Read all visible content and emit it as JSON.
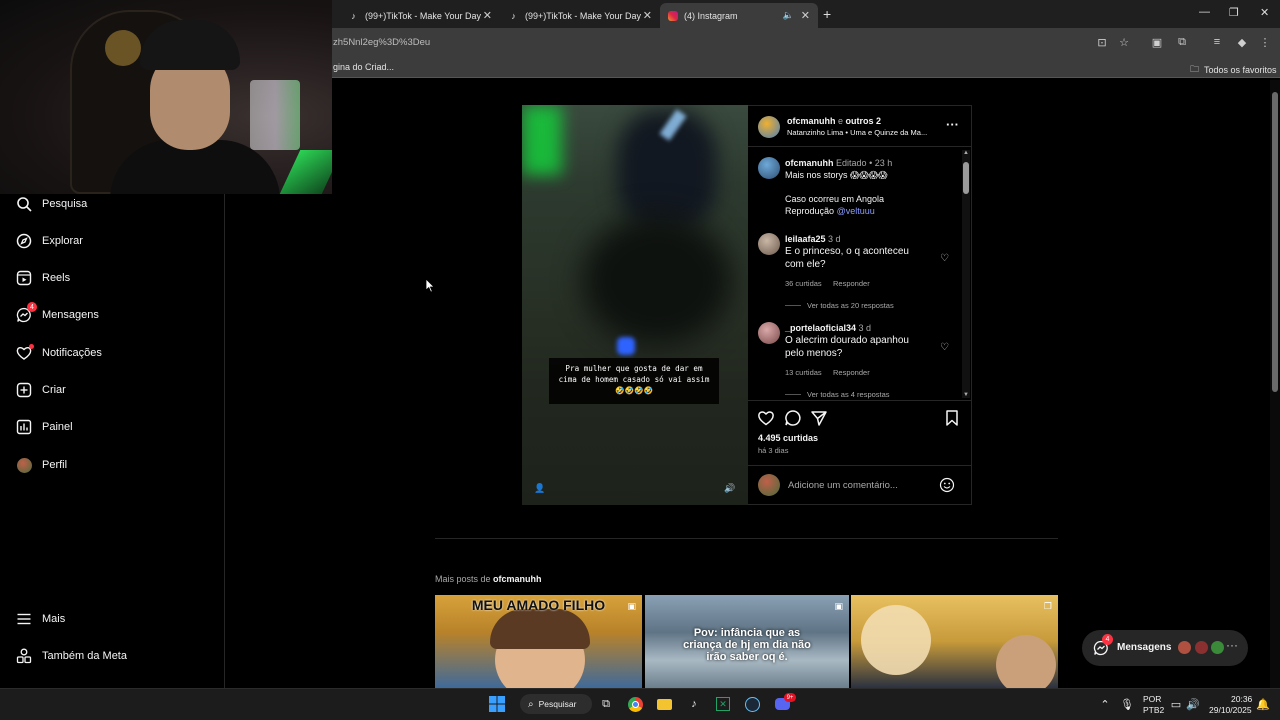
{
  "browser": {
    "tabs": [
      {
        "title": "(99+)TikTok - Make Your Day",
        "icon": "tiktok-icon"
      },
      {
        "title": "(99+)TikTok - Make Your Day",
        "icon": "tiktok-icon"
      },
      {
        "title": "(4) Instagram",
        "icon": "instagram-icon",
        "active": true
      }
    ],
    "url": "zh5Nnl2eg%3D%3Deu",
    "bookmark_left": "gina do Criad...",
    "bookmark_right": "Todos os favoritos"
  },
  "sidebar": {
    "items": [
      {
        "label": "Pesquisa",
        "icon": "search-icon"
      },
      {
        "label": "Explorar",
        "icon": "compass-icon"
      },
      {
        "label": "Reels",
        "icon": "reels-icon"
      },
      {
        "label": "Mensagens",
        "icon": "messenger-icon",
        "badge": "4"
      },
      {
        "label": "Notificações",
        "icon": "heart-icon"
      },
      {
        "label": "Criar",
        "icon": "plus-square-icon"
      },
      {
        "label": "Painel",
        "icon": "chart-icon"
      },
      {
        "label": "Perfil",
        "icon": "avatar-icon"
      }
    ],
    "bottom": [
      {
        "label": "Mais",
        "icon": "menu-icon"
      },
      {
        "label": "Também da Meta",
        "icon": "meta-apps-icon"
      }
    ]
  },
  "post": {
    "video_caption": "Pra mulher que gosta de dar em cima de homem casado só vai assim 🤣🤣🤣🤣",
    "header": {
      "author": "ofcmanuhh",
      "connector": "e",
      "others": "outros 2",
      "audio": "Natanzinho Lima • Uma e Quinze da Ma..."
    },
    "caption": {
      "author": "ofcmanuhh",
      "edited": "Editado",
      "time": "23 h",
      "line1": "Mais nos storys 😱😱😱😱",
      "line2": "Caso ocorreu em Angola",
      "line3_prefix": "Reprodução",
      "line3_link": "@veltuuu"
    },
    "comments": [
      {
        "user": "leilaafa25",
        "time": "3 d",
        "line1": "E o princeso, o q aconteceu",
        "line2": "com ele?",
        "likes": "36 curtidas",
        "reply": "Responder",
        "view_replies": "Ver todas as 20 respostas"
      },
      {
        "user": "_portelaoficial34",
        "time": "3 d",
        "line1": "O alecrim dourado apanhou",
        "line2": "pelo menos?",
        "likes": "13 curtidas",
        "reply": "Responder",
        "view_replies": "Ver todas as 4 respostas"
      }
    ],
    "likes": "4.495 curtidas",
    "posted": "há 3 dias",
    "comment_placeholder": "Adicione um comentário..."
  },
  "more_posts": {
    "prefix": "Mais posts de",
    "author": "ofcmanuhh",
    "thumbs": [
      {
        "text": "MEU AMADO FILHO"
      },
      {
        "text": "Pov: infância que as criança de hj em dia não irão saber oq é."
      },
      {
        "text": ""
      }
    ]
  },
  "messages_pill": {
    "label": "Mensagens",
    "badge": "4"
  },
  "taskbar": {
    "search": "Pesquisar",
    "lang1": "POR",
    "lang2": "PTB2",
    "time": "20:36",
    "date": "29/10/2025",
    "discord_badge": "9+"
  },
  "colors": {
    "accent_link": "#8b9cff",
    "badge_red": "#ff3040",
    "background": "#000000"
  }
}
